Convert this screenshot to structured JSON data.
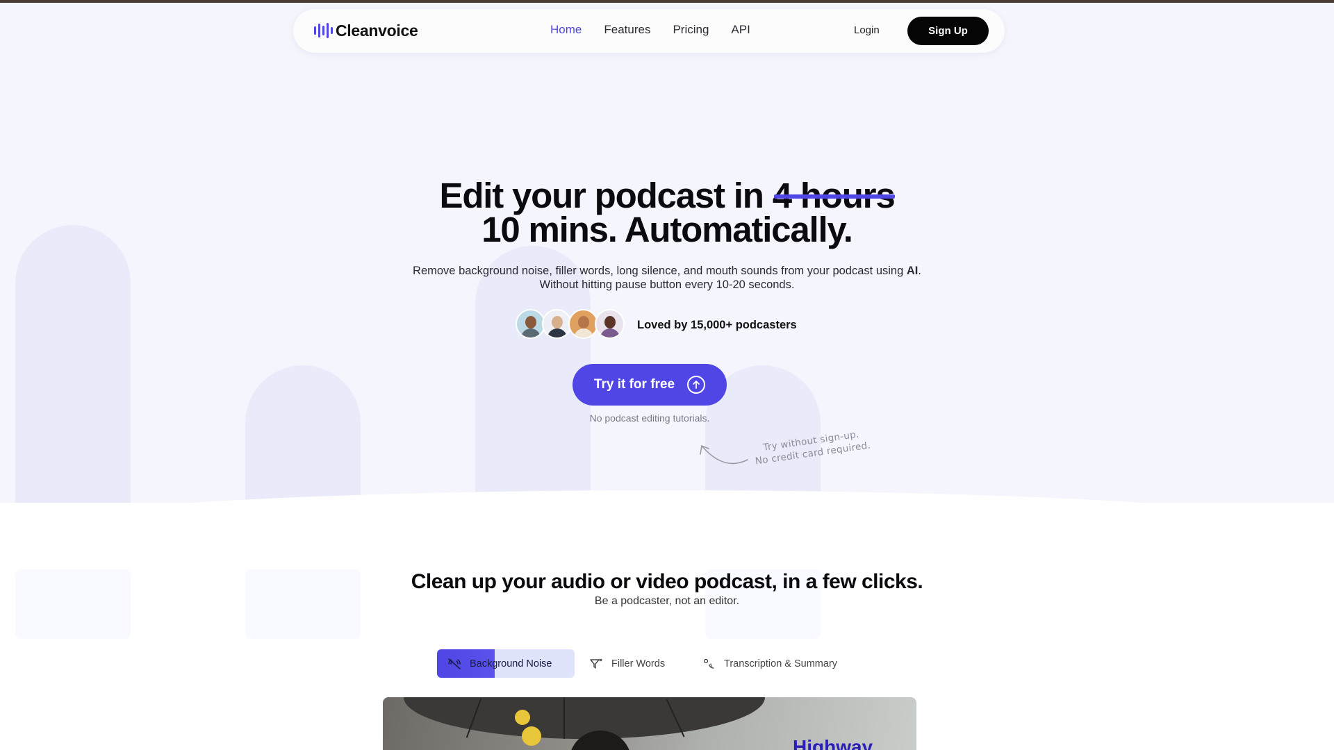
{
  "nav": {
    "brand": "Cleanvoice",
    "links": [
      {
        "label": "Home",
        "active": true
      },
      {
        "label": "Features",
        "active": false
      },
      {
        "label": "Pricing",
        "active": false
      },
      {
        "label": "API",
        "active": false
      }
    ],
    "login": "Login",
    "signup": "Sign Up"
  },
  "hero": {
    "headline_prefix": "Edit your podcast in ",
    "headline_struck": "4 hours",
    "headline_line2": "10 mins. Automatically.",
    "subtitle_line1_pre": "Remove background noise, filler words, long silence, and mouth sounds from your podcast using ",
    "subtitle_line1_bold": "AI",
    "subtitle_line1_post": ".",
    "subtitle_line2": "Without hitting pause button every 10-20 seconds.",
    "social_proof": "Loved by 15,000+ podcasters",
    "cta_label": "Try it for free",
    "cta_note": "No podcast editing tutorials.",
    "handnote_line1": "Try without sign-up.",
    "handnote_line2": "No credit card required."
  },
  "section": {
    "title": "Clean up your audio or video podcast, in a few clicks.",
    "subtitle": "Be a podcaster, not an editor.",
    "tabs": [
      {
        "label": "Background Noise",
        "icon": "muted-waves-icon",
        "active": true
      },
      {
        "label": "Filler Words",
        "icon": "filter-icon",
        "active": false
      },
      {
        "label": "Transcription & Summary",
        "icon": "translate-icon",
        "active": false
      }
    ],
    "video_overlay_text": "Highway"
  },
  "colors": {
    "accent": "#4f46e5",
    "hero_bg": "#f4f5fd",
    "dark": "#050505"
  }
}
